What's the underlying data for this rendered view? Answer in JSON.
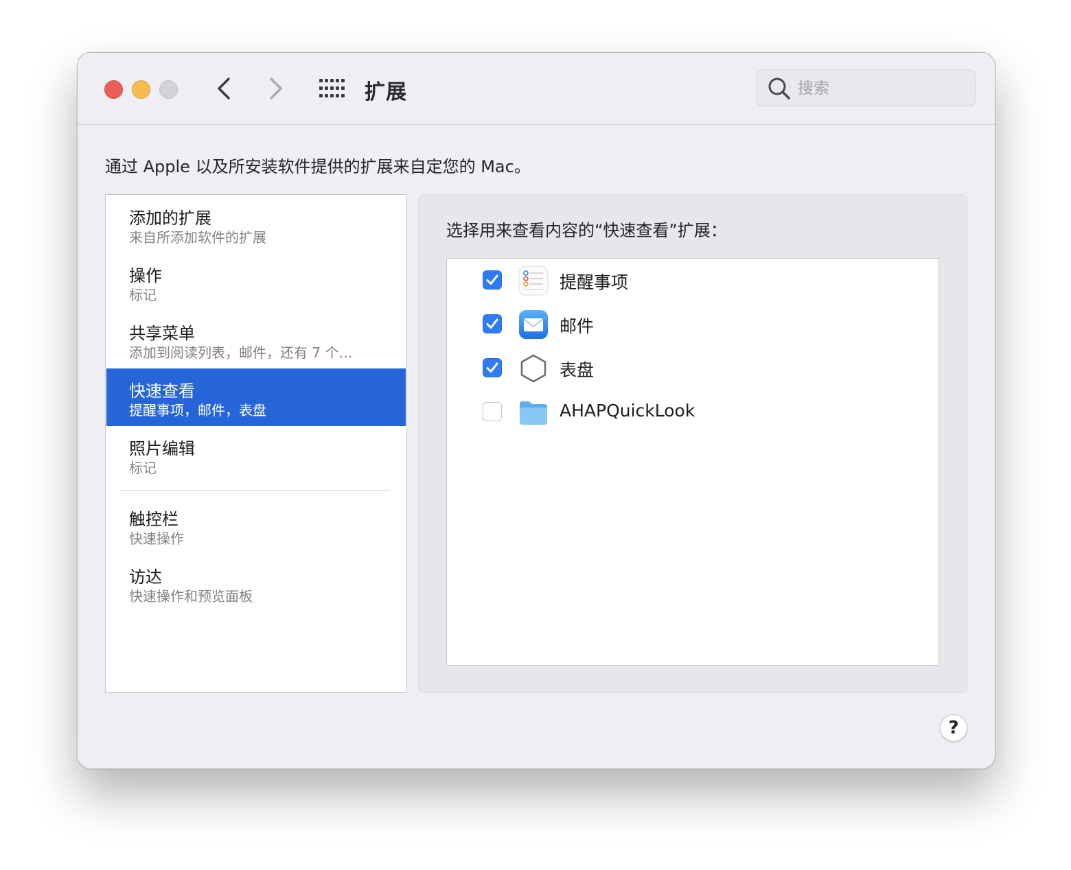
{
  "window": {
    "title": "扩展",
    "search_placeholder": "搜索",
    "description": "通过 Apple 以及所安装软件提供的扩展来自定您的 Mac。"
  },
  "sidebar": {
    "items": [
      {
        "title": "添加的扩展",
        "subtitle": "来自所添加软件的扩展"
      },
      {
        "title": "操作",
        "subtitle": "标记"
      },
      {
        "title": "共享菜单",
        "subtitle": "添加到阅读列表，邮件，还有 7 个…"
      },
      {
        "title": "快速查看",
        "subtitle": "提醒事项，邮件，表盘",
        "selected": true
      },
      {
        "title": "照片编辑",
        "subtitle": "标记"
      },
      {
        "title": "触控栏",
        "subtitle": "快速操作"
      },
      {
        "title": "访达",
        "subtitle": "快速操作和预览面板"
      }
    ]
  },
  "panel": {
    "label": "选择用来查看内容的“快速查看”扩展：",
    "extensions": [
      {
        "name": "提醒事项",
        "checked": true,
        "icon": "reminders-icon"
      },
      {
        "name": "邮件",
        "checked": true,
        "icon": "mail-icon"
      },
      {
        "name": "表盘",
        "checked": true,
        "icon": "hexagon-icon"
      },
      {
        "name": "AHAPQuickLook",
        "checked": false,
        "icon": "folder-icon"
      }
    ]
  },
  "help": {
    "label": "?"
  },
  "colors": {
    "accent": "#2665d8",
    "checkbox_on": "#2f7bf5",
    "close": "#ec5f58",
    "minimize": "#f5bd4f",
    "zoom_inactive": "#d4d3d8"
  }
}
